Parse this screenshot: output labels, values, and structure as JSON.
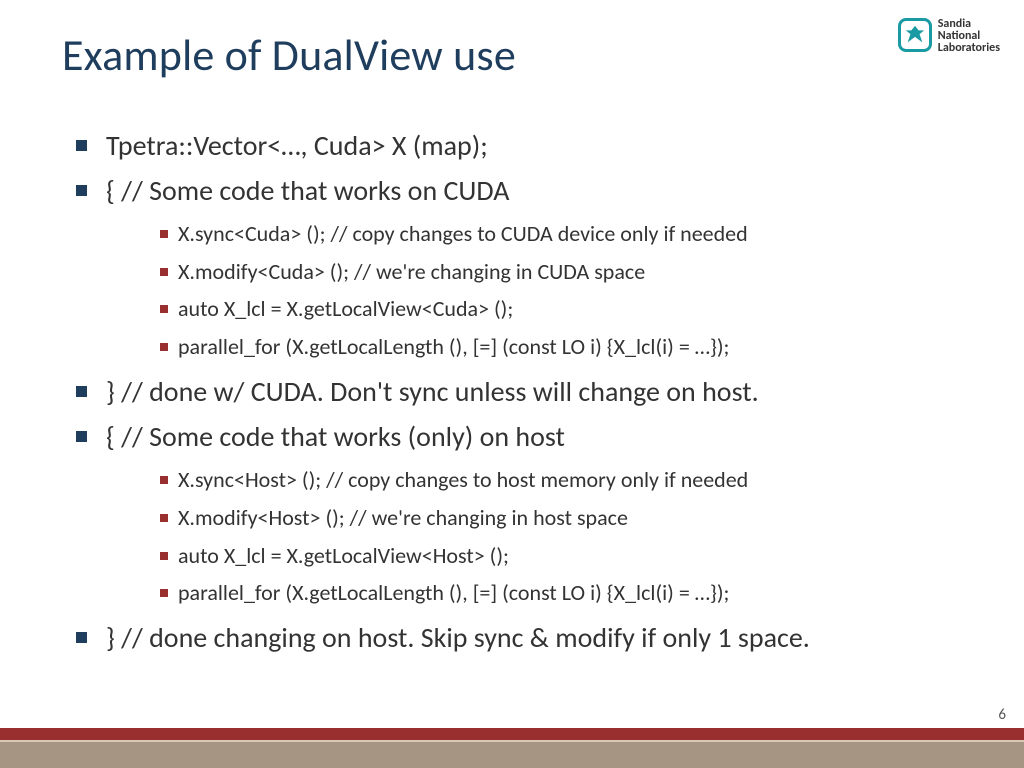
{
  "title": "Example of DualView use",
  "logo": {
    "line1": "Sandia",
    "line2": "National",
    "line3": "Laboratories"
  },
  "page_number": "6",
  "bullets": [
    {
      "text": "Tpetra::Vector<…, Cuda> X (map);",
      "sub": []
    },
    {
      "text": "{ // Some code that works on CUDA",
      "sub": [
        "X.sync<Cuda> (); // copy changes to CUDA device only if needed",
        "X.modify<Cuda> (); // we're changing in CUDA space",
        "auto X_lcl = X.getLocalView<Cuda> ();",
        "parallel_for (X.getLocalLength (), [=] (const LO i) {X_lcl(i) = …});"
      ]
    },
    {
      "text": "} // done w/ CUDA.  Don't sync unless will change on host.",
      "sub": []
    },
    {
      "text": "{ // Some code that works (only) on host",
      "sub": [
        "X.sync<Host> (); // copy changes to host memory only if needed",
        "X.modify<Host> (); // we're changing in host space",
        "auto X_lcl = X.getLocalView<Host> ();",
        "parallel_for (X.getLocalLength (), [=] (const LO i) {X_lcl(i) = …});"
      ]
    },
    {
      "text": "} // done changing on host. Skip sync & modify if only 1 space.",
      "sub": []
    }
  ]
}
